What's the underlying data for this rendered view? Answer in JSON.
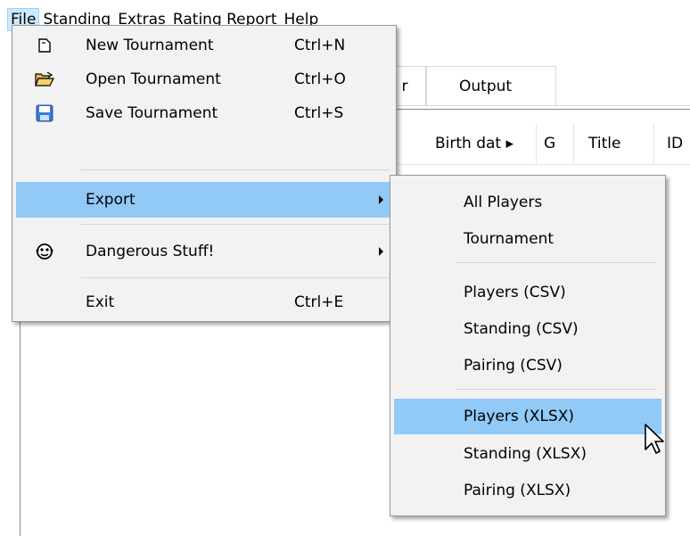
{
  "menubar": {
    "items": [
      "File",
      "Standing",
      "Extras",
      "Rating Report",
      "Help"
    ]
  },
  "tabs": {
    "partial_label": "r",
    "output_label": "Output"
  },
  "grid": {
    "headers": [
      "Birth dat ▸",
      "G",
      "Title",
      "ID"
    ]
  },
  "file_menu": {
    "new": {
      "label": "New Tournament",
      "shortcut": "Ctrl+N",
      "icon": "new-document-icon"
    },
    "open": {
      "label": "Open Tournament",
      "shortcut": "Ctrl+O",
      "icon": "open-folder-icon"
    },
    "save": {
      "label": "Save Tournament",
      "shortcut": "Ctrl+S",
      "icon": "floppy-disk-icon"
    },
    "export": {
      "label": "Export"
    },
    "dangerous": {
      "label": "Dangerous Stuff!",
      "icon": "monkey-face-icon"
    },
    "exit": {
      "label": "Exit",
      "shortcut": "Ctrl+E"
    }
  },
  "export_menu": {
    "items": [
      "All Players",
      "Tournament",
      "Players (CSV)",
      "Standing (CSV)",
      "Pairing (CSV)",
      "Players (XLSX)",
      "Standing (XLSX)",
      "Pairing (XLSX)"
    ],
    "highlighted": "Players (XLSX)"
  },
  "colors": {
    "menu_bg": "#f2f2f2",
    "highlight": "#91c9f7",
    "menubar_active": "#cce8ff"
  }
}
